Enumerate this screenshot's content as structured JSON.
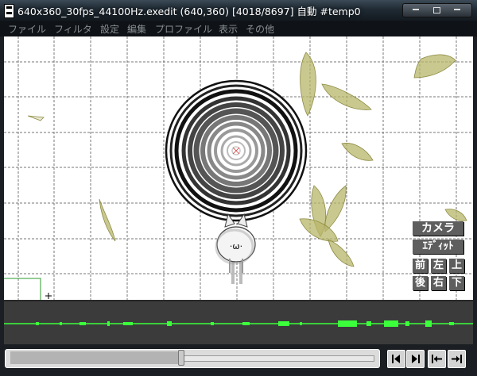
{
  "window": {
    "title": "640x360_30fps_44100Hz.exedit (640,360)  [4018/8697]  自動  #temp0",
    "icon": "film-icon"
  },
  "menu": [
    "ファイル",
    "フィルタ",
    "設定",
    "編集",
    "プロファイル",
    "表示",
    "その他"
  ],
  "camera_panel": {
    "camera_label": "カメラ",
    "edit_label": "ｴﾃﾞｨｯﾄ",
    "front_label": "前",
    "left_label": "左",
    "top_label": "上",
    "back_label": "後",
    "right_label": "右",
    "bottom_label": "下"
  },
  "seek": {
    "position": 0.462,
    "selection_start": 0.0,
    "selection_end": 0.462
  },
  "nav_buttons": [
    "prev-frame-icon",
    "next-frame-icon",
    "first-frame-icon",
    "last-frame-icon"
  ],
  "colors": {
    "waveform": "#3cff3c",
    "leaf": "#b7b56a",
    "grid": "#777777"
  },
  "cursor_icon": "crosshair-icon"
}
